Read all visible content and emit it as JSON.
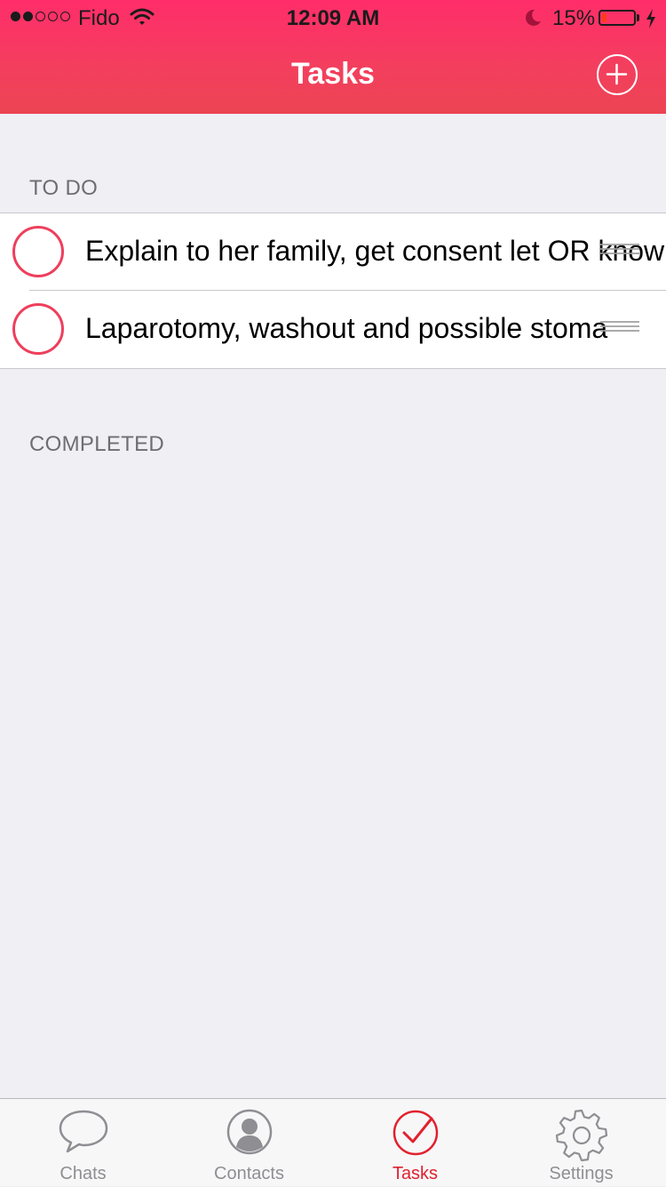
{
  "status_bar": {
    "carrier": "Fido",
    "time": "12:09 AM",
    "battery_percent": "15%",
    "battery_level": 0.15,
    "signal_strength": 2,
    "signal_max": 5
  },
  "nav": {
    "title": "Tasks",
    "add_icon": "plus-circle-icon"
  },
  "sections": {
    "todo_header": "TO DO",
    "completed_header": "COMPLETED"
  },
  "todo_items": [
    {
      "text": "Explain to her family, get consent let OR know"
    },
    {
      "text": "Laparotomy, washout and possible stoma"
    }
  ],
  "tab_bar": {
    "tabs": [
      {
        "label": "Chats",
        "icon": "chat-bubble-icon",
        "active": false
      },
      {
        "label": "Contacts",
        "icon": "contact-person-icon",
        "active": false
      },
      {
        "label": "Tasks",
        "icon": "checkmark-circle-icon",
        "active": true
      },
      {
        "label": "Settings",
        "icon": "gear-icon",
        "active": false
      }
    ]
  },
  "colors": {
    "accent": "#ee3f5c",
    "header_top": "#ff2d6a",
    "header_bottom": "#ec4452",
    "active_tab": "#e2202e",
    "inactive_tab": "#8e8e93",
    "background": "#efeff4"
  }
}
